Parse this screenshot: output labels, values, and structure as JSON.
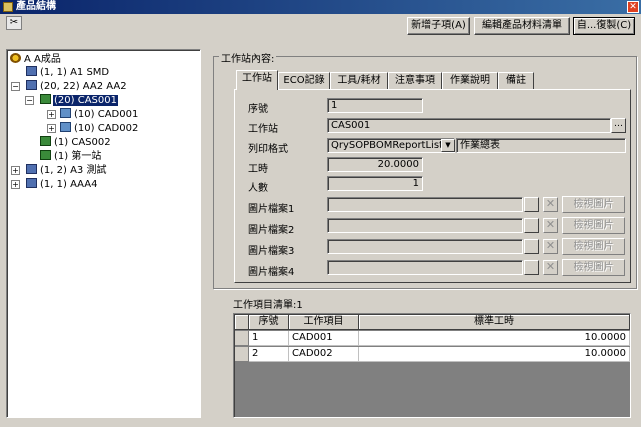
{
  "window": {
    "title": "產品結構"
  },
  "toolbar": {
    "new_child": "新增子項(A)",
    "edit_bom": "編輯產品材料清單",
    "restore": "自...復製(C)"
  },
  "tree": {
    "nodes": [
      {
        "label": "A A成品"
      },
      {
        "label": "(1, 1) A1 SMD"
      },
      {
        "label": "(20, 22) AA2 AA2"
      },
      {
        "label": "(20) CAS001"
      },
      {
        "label": "(10) CAD001"
      },
      {
        "label": "(10) CAD002"
      },
      {
        "label": "(1) CAS002"
      },
      {
        "label": "(1) 第一站"
      },
      {
        "label": "(1, 2) A3 測試"
      },
      {
        "label": "(1, 1) AAA4"
      }
    ]
  },
  "station": {
    "group_title": "工作站內容:",
    "tabs": [
      "工作站",
      "ECO記錄",
      "工具/耗材",
      "注意事項",
      "作業說明",
      "備註"
    ],
    "fields": {
      "seq_label": "序號",
      "seq_value": "1",
      "station_label": "工作站",
      "station_value": "CAS001",
      "print_label": "列印格式",
      "print_value": "QrySOPBOMReportListQ",
      "print_desc": "作業總表",
      "hours_label": "工時",
      "hours_value": "20.0000",
      "people_label": "人數",
      "people_value": "1"
    },
    "image_files": [
      {
        "label": "圖片檔案1",
        "view": "檢視圖片"
      },
      {
        "label": "圖片檔案2",
        "view": "檢視圖片"
      },
      {
        "label": "圖片檔案3",
        "view": "檢視圖片"
      },
      {
        "label": "圖片檔案4",
        "view": "檢視圖片"
      }
    ]
  },
  "worklist": {
    "title": "工作項目清單:1",
    "columns": [
      "序號",
      "工作項目",
      "標準工時"
    ],
    "rows": [
      {
        "seq": "1",
        "item": "CAD001",
        "time": "10.0000"
      },
      {
        "seq": "2",
        "item": "CAD002",
        "time": "10.0000"
      }
    ]
  },
  "icons": {
    "ellipsis": "…",
    "delete": "✕",
    "dropdown": "▼",
    "close": "✕",
    "expand": "+",
    "collapse": "−"
  }
}
